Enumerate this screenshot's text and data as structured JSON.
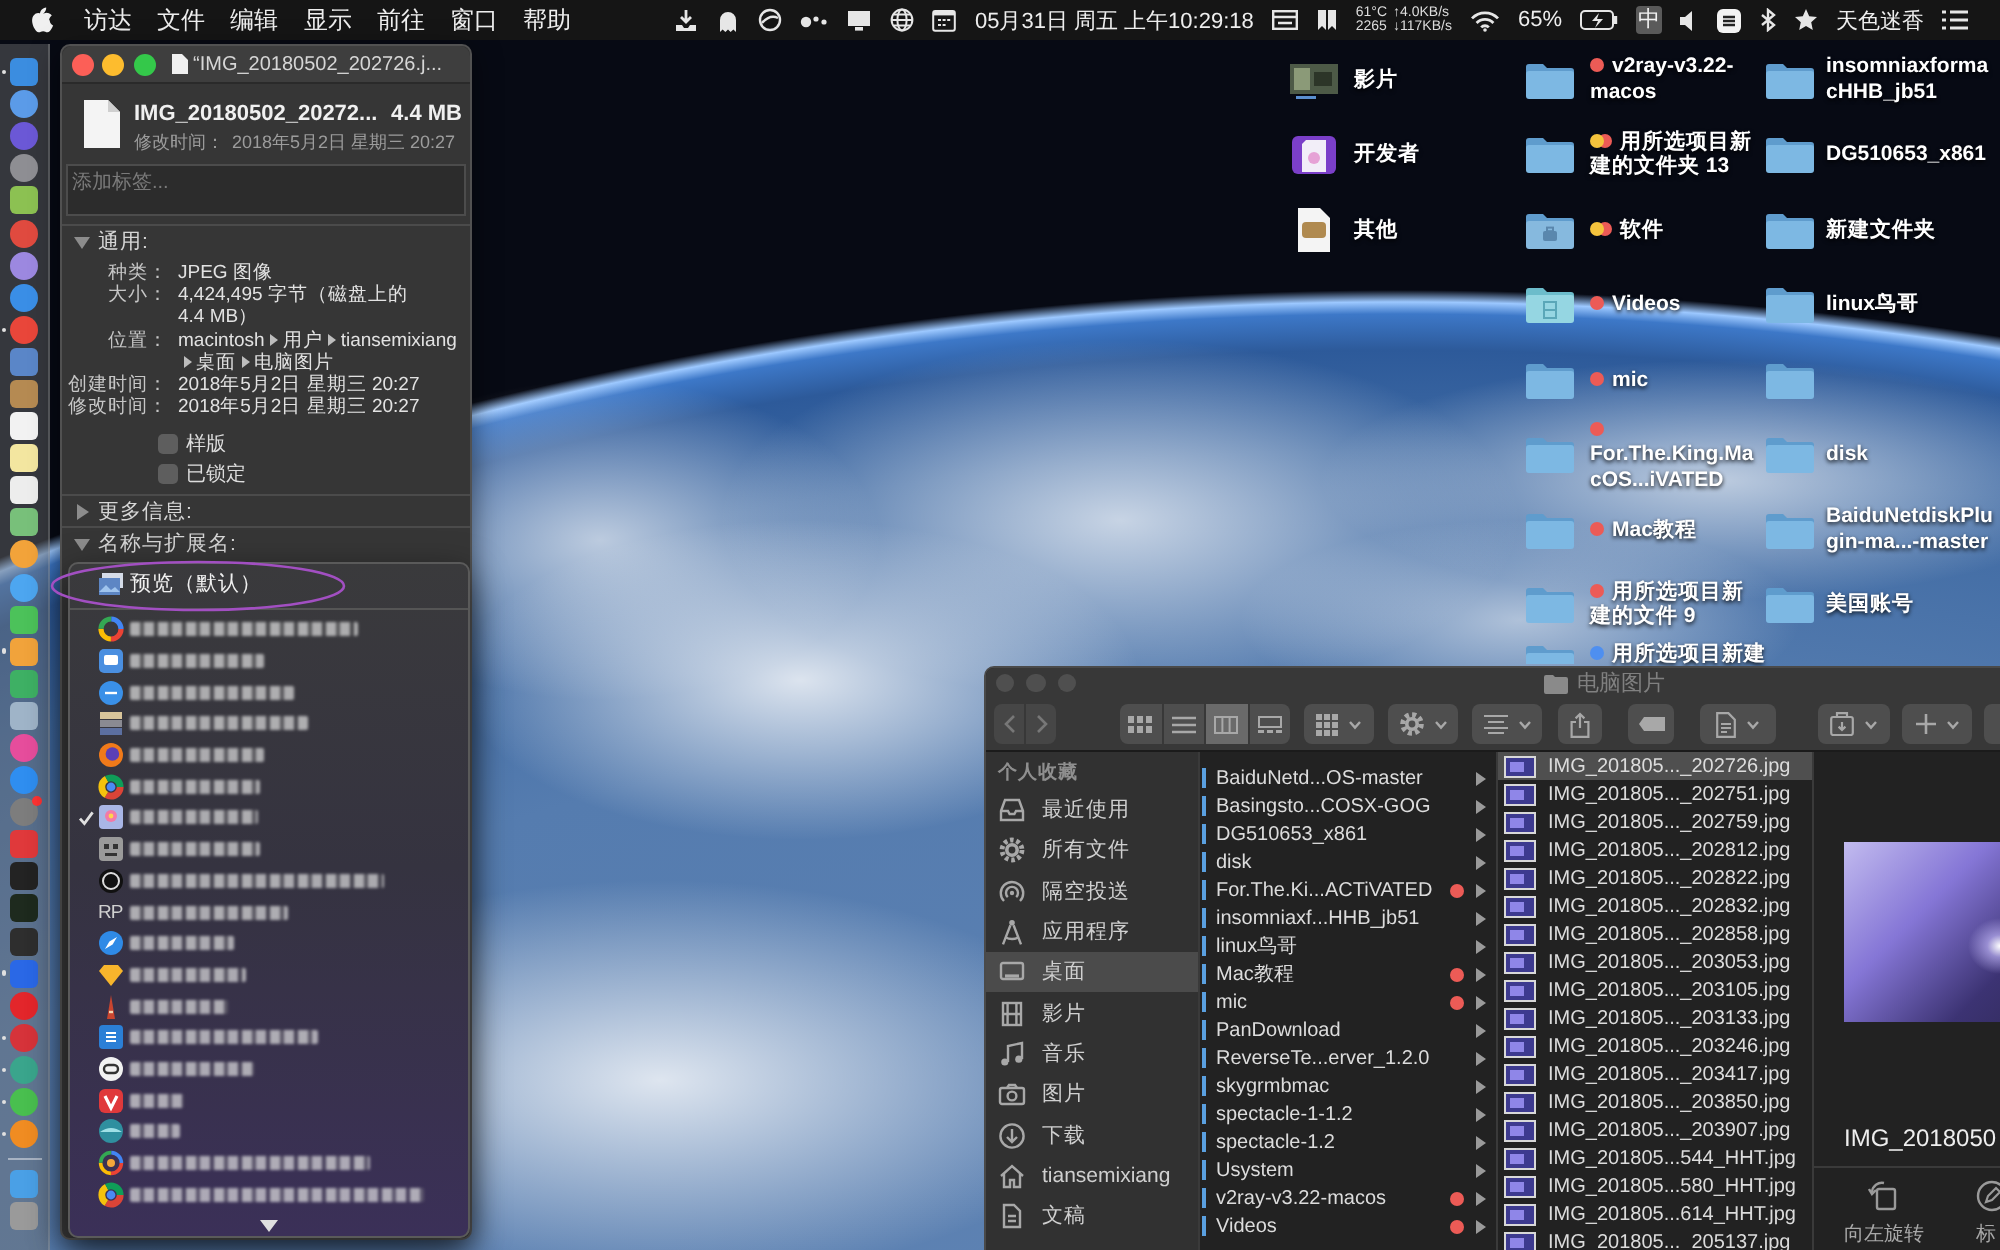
{
  "menu_bar": {
    "menus": [
      "访达",
      "文件",
      "编辑",
      "显示",
      "前往",
      "窗口",
      "帮助"
    ],
    "clock": "05月31日 周五 上午10:29:18",
    "temperature": "61°C",
    "upload": "↑4.0KB/s",
    "fan_speed": "2265",
    "download": "↓117KB/s",
    "battery": "65%",
    "input_method": "中",
    "user": "天色迷香"
  },
  "dock": {
    "apps": [
      {
        "kind": "square",
        "color": "#3b8de0",
        "running": true,
        "badge": false
      },
      {
        "kind": "round",
        "color": "#5b9be8",
        "running": false,
        "badge": false
      },
      {
        "kind": "round",
        "color": "#6b58d6",
        "running": false,
        "badge": false
      },
      {
        "kind": "round",
        "color": "#8e8e93",
        "running": false,
        "badge": false
      },
      {
        "kind": "square",
        "color": "#8cc152",
        "running": false,
        "badge": false
      },
      {
        "kind": "round",
        "color": "#e04a3f",
        "running": false,
        "badge": false
      },
      {
        "kind": "round",
        "color": "#9c88e0",
        "running": false,
        "badge": false
      },
      {
        "kind": "round",
        "color": "#3a8ee6",
        "running": false,
        "badge": false
      },
      {
        "kind": "round",
        "color": "#e9463a",
        "running": true,
        "badge": false
      },
      {
        "kind": "square",
        "color": "#5a86c8",
        "running": false,
        "badge": false
      },
      {
        "kind": "square",
        "color": "#b58a52",
        "running": false,
        "badge": false
      },
      {
        "kind": "square",
        "color": "#f2f2f2",
        "running": false,
        "badge": false
      },
      {
        "kind": "square",
        "color": "#f3e6a0",
        "running": false,
        "badge": false
      },
      {
        "kind": "square",
        "color": "#ededed",
        "running": false,
        "badge": false
      },
      {
        "kind": "square",
        "color": "#78c07a",
        "running": false,
        "badge": false
      },
      {
        "kind": "round",
        "color": "#f2a33a",
        "running": false,
        "badge": false
      },
      {
        "kind": "round",
        "color": "#4da6f0",
        "running": false,
        "badge": false
      },
      {
        "kind": "square",
        "color": "#4cc25a",
        "running": false,
        "badge": false
      },
      {
        "kind": "square",
        "color": "#f1a33b",
        "running": true,
        "badge": false
      },
      {
        "kind": "square",
        "color": "#3eb064",
        "running": false,
        "badge": false
      },
      {
        "kind": "square",
        "color": "#9fb4c8",
        "running": false,
        "badge": false
      },
      {
        "kind": "round",
        "color": "#e64d9c",
        "running": false,
        "badge": false
      },
      {
        "kind": "round",
        "color": "#2f8ef0",
        "running": false,
        "badge": false
      },
      {
        "kind": "round",
        "color": "#7d7d7d",
        "running": false,
        "badge": true
      },
      {
        "kind": "square",
        "color": "#e0393b",
        "running": false,
        "badge": false
      },
      {
        "kind": "square",
        "color": "#232323",
        "running": false,
        "badge": false
      },
      {
        "kind": "square",
        "color": "#1e2a1e",
        "running": false,
        "badge": false
      },
      {
        "kind": "square",
        "color": "#2e2e2e",
        "running": false,
        "badge": false
      },
      {
        "kind": "square",
        "color": "#2a68e6",
        "running": true,
        "badge": false
      },
      {
        "kind": "round",
        "color": "#e3262b",
        "running": false,
        "badge": false
      },
      {
        "kind": "round",
        "color": "#d6333a",
        "running": true,
        "badge": false
      },
      {
        "kind": "round",
        "color": "#3aa58c",
        "running": true,
        "badge": false
      },
      {
        "kind": "round",
        "color": "#49bf4f",
        "running": true,
        "badge": false
      },
      {
        "kind": "round",
        "color": "#f08c22",
        "running": true,
        "badge": false
      }
    ],
    "stacks": [
      {
        "kind": "square",
        "color": "#4aa0e6",
        "running": false,
        "badge": false
      },
      {
        "kind": "square",
        "color": "#9a9a9a",
        "running": false,
        "badge": false
      }
    ]
  },
  "info_window": {
    "title": "“IMG_20180502_202726.j...",
    "focused": true,
    "file_name": "IMG_20180502_20272...",
    "size": "4.4 MB",
    "modified_label": "修改时间：",
    "modified": "2018年5月2日 星期三 20:27",
    "tags_field": {
      "placeholder": "添加标签..."
    },
    "sections": [
      {
        "title": "通用:",
        "expanded": true,
        "rows": [
          {
            "kind": "text",
            "label": "种类：",
            "value": "JPEG 图像"
          },
          {
            "kind": "text",
            "label": "大小：",
            "value": "4,424,495 字节（磁盘上的 4.4 MB）"
          },
          {
            "kind": "path",
            "label": "位置：",
            "segments": [
              "macintosh",
              "用户",
              "tiansemixiang",
              "桌面",
              "电脑图片"
            ]
          },
          {
            "kind": "text",
            "label": "创建时间：",
            "value": "2018年5月2日 星期三 20:27"
          },
          {
            "kind": "text",
            "label": "修改时间：",
            "value": "2018年5月2日 星期三 20:27"
          }
        ],
        "checkboxes": [
          {
            "label": "样版",
            "checked": false
          },
          {
            "label": "已锁定",
            "checked": false
          }
        ]
      },
      {
        "title": "更多信息:",
        "expanded": false
      },
      {
        "title": "名称与扩展名:",
        "expanded": true
      }
    ],
    "open_with_menu": {
      "default_app": {
        "label": "预览（默认）",
        "circled": true
      },
      "apps": [
        {
          "kind": "quadring",
          "checked": false
        },
        {
          "kind": "screen",
          "checked": false
        },
        {
          "kind": "bubble",
          "checked": false
        },
        {
          "kind": "drawers",
          "checked": false
        },
        {
          "kind": "foxball",
          "checked": false
        },
        {
          "kind": "tricolor",
          "checked": false
        },
        {
          "kind": "flower",
          "checked": true
        },
        {
          "kind": "robot",
          "checked": false
        },
        {
          "kind": "ring",
          "checked": false
        },
        {
          "kind": "initials",
          "icon_text": "RP",
          "checked": false
        },
        {
          "kind": "compass",
          "checked": false
        },
        {
          "kind": "diamond",
          "checked": false
        },
        {
          "kind": "pencil",
          "checked": false
        },
        {
          "kind": "tile",
          "checked": false
        },
        {
          "kind": "disc",
          "checked": false
        },
        {
          "kind": "vee",
          "checked": false
        },
        {
          "kind": "sphere",
          "checked": false
        },
        {
          "kind": "wheel",
          "checked": false
        },
        {
          "kind": "tricolor",
          "checked": false
        }
      ]
    }
  },
  "desktop": {
    "columns": [
      [
        {
          "kind": "video-thumbnail",
          "label": "影片"
        },
        {
          "kind": "app-document",
          "label": "开发者"
        },
        {
          "kind": "archive",
          "label": "其他"
        }
      ],
      [
        {
          "kind": "folder",
          "label": "v2ray-v3.22-macos",
          "tags": [
            {
              "color": "#ec5b56"
            }
          ]
        },
        {
          "kind": "folder",
          "label": "用所选项目新建的文件夹 13",
          "tags": [
            {
              "color": "#f4c33d"
            },
            {
              "color": "#ec5b56"
            }
          ]
        },
        {
          "kind": "briefcase-folder",
          "label": "软件",
          "tags": [
            {
              "color": "#f4c33d"
            },
            {
              "color": "#ec5b56"
            }
          ]
        },
        {
          "kind": "film-folder",
          "label": "Videos",
          "tags": [
            {
              "color": "#ec5b56"
            }
          ]
        },
        {
          "kind": "folder",
          "label": "mic",
          "tags": [
            {
              "color": "#ec5b56"
            }
          ]
        },
        {
          "kind": "folder",
          "label": "For.The.King.MacOS...iVATED",
          "tags": [
            {
              "color": "#ec5b56"
            }
          ]
        },
        {
          "kind": "folder",
          "label": "Mac教程",
          "tags": [
            {
              "color": "#ec5b56"
            }
          ]
        },
        {
          "kind": "folder",
          "label": "用所选项目新建的文件 9",
          "tags": [
            {
              "color": "#ec5b56"
            }
          ]
        },
        {
          "kind": "folder",
          "label": "用所选项目新建",
          "tags": [
            {
              "color": "#4e8ff0"
            }
          ]
        }
      ],
      [
        {
          "kind": "folder",
          "label": "insomniaxformacHHB_jb51"
        },
        {
          "kind": "folder",
          "label": "DG510653_x861"
        },
        {
          "kind": "folder",
          "label": "新建文件夹"
        },
        {
          "kind": "folder",
          "label": "linux鸟哥"
        },
        {
          "kind": "folder"
        },
        {
          "kind": "folder",
          "label": "disk"
        },
        {
          "kind": "folder",
          "label": "BaiduNetdiskPlugin-ma...-master"
        },
        {
          "kind": "folder",
          "label": "美国账号"
        }
      ]
    ]
  },
  "finder_window": {
    "title": "电脑图片",
    "focused": false,
    "view_modes": [
      {
        "kind": "icons",
        "selected": false
      },
      {
        "kind": "list",
        "selected": false
      },
      {
        "kind": "columns",
        "selected": true
      },
      {
        "kind": "gallery",
        "selected": false
      }
    ],
    "sidebar": {
      "heading": "个人收藏",
      "items": [
        {
          "kind": "recents",
          "label": "最近使用",
          "selected": false
        },
        {
          "kind": "all-files",
          "label": "所有文件",
          "selected": false
        },
        {
          "kind": "airdrop",
          "label": "隔空投送",
          "selected": false
        },
        {
          "kind": "applications",
          "label": "应用程序",
          "selected": false
        },
        {
          "kind": "desktop",
          "label": "桌面",
          "selected": true
        },
        {
          "kind": "movies",
          "label": "影片",
          "selected": false
        },
        {
          "kind": "music",
          "label": "音乐",
          "selected": false
        },
        {
          "kind": "pictures",
          "label": "图片",
          "selected": false
        },
        {
          "kind": "downloads",
          "label": "下载",
          "selected": false
        },
        {
          "kind": "home",
          "label": "tiansemixiang",
          "selected": false
        },
        {
          "kind": "documents",
          "label": "文稿",
          "selected": false
        }
      ]
    },
    "folders": [
      {
        "name": "BaiduNetd...OS-master"
      },
      {
        "name": "Basingsto...COSX-GOG"
      },
      {
        "name": "DG510653_x861"
      },
      {
        "name": "disk"
      },
      {
        "name": "For.The.Ki...ACTiVATED",
        "color": "#ec5b56"
      },
      {
        "name": "insomniaxf...HHB_jb51"
      },
      {
        "name": "linux鸟哥"
      },
      {
        "name": "Mac教程",
        "color": "#ec5b56"
      },
      {
        "name": "mic",
        "color": "#ec5b56"
      },
      {
        "name": "PanDownload"
      },
      {
        "name": "ReverseTe...erver_1.2.0"
      },
      {
        "name": "skygrmbmac"
      },
      {
        "name": "spectacle-1-1.2"
      },
      {
        "name": "spectacle-1.2"
      },
      {
        "name": "Usystem"
      },
      {
        "name": "v2ray-v3.22-macos",
        "color": "#ec5b56"
      },
      {
        "name": "Videos",
        "color": "#ec5b56"
      }
    ],
    "files": [
      {
        "name": "IMG_201805..._202726.jpg",
        "selected": true
      },
      {
        "name": "IMG_201805..._202751.jpg",
        "selected": false
      },
      {
        "name": "IMG_201805..._202759.jpg",
        "selected": false
      },
      {
        "name": "IMG_201805..._202812.jpg",
        "selected": false
      },
      {
        "name": "IMG_201805..._202822.jpg",
        "selected": false
      },
      {
        "name": "IMG_201805..._202832.jpg",
        "selected": false
      },
      {
        "name": "IMG_201805..._202858.jpg",
        "selected": false
      },
      {
        "name": "IMG_201805..._203053.jpg",
        "selected": false
      },
      {
        "name": "IMG_201805..._203105.jpg",
        "selected": false
      },
      {
        "name": "IMG_201805..._203133.jpg",
        "selected": false
      },
      {
        "name": "IMG_201805..._203246.jpg",
        "selected": false
      },
      {
        "name": "IMG_201805..._203417.jpg",
        "selected": false
      },
      {
        "name": "IMG_201805..._203850.jpg",
        "selected": false
      },
      {
        "name": "IMG_201805..._203907.jpg",
        "selected": false
      },
      {
        "name": "IMG_201805...544_HHT.jpg",
        "selected": false
      },
      {
        "name": "IMG_201805...580_HHT.jpg",
        "selected": false
      },
      {
        "name": "IMG_201805...614_HHT.jpg",
        "selected": false
      },
      {
        "name": "IMG_201805..._205137.jpg",
        "selected": false
      }
    ],
    "preview": {
      "file_name": "IMG_2018050",
      "actions": [
        {
          "kind": "rotate-left",
          "label": "向左旋转"
        },
        {
          "kind": "markup",
          "label": "标"
        }
      ]
    }
  }
}
